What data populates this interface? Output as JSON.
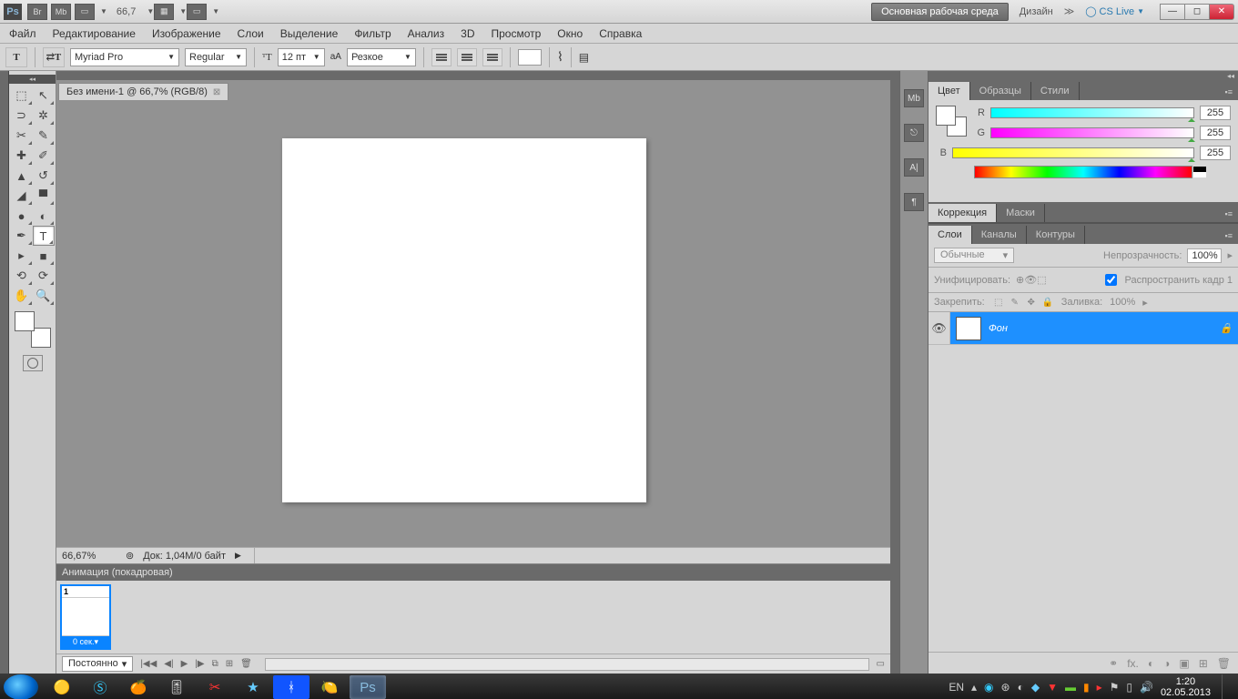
{
  "titlebar": {
    "zoom": "66,7",
    "workspace_btn": "Основная рабочая среда",
    "design_label": "Дизайн",
    "cslive": "CS Live"
  },
  "menubar": [
    "Файл",
    "Редактирование",
    "Изображение",
    "Слои",
    "Выделение",
    "Фильтр",
    "Анализ",
    "3D",
    "Просмотр",
    "Окно",
    "Справка"
  ],
  "optbar": {
    "font_family": "Myriad Pro",
    "font_style": "Regular",
    "font_size": "12 пт",
    "aa_label": "aA",
    "aa_mode": "Резкое"
  },
  "document": {
    "tab_title": "Без имени-1 @ 66,7% (RGB/8)",
    "status_zoom": "66,67%",
    "status_doc": "Док: 1,04M/0 байт"
  },
  "animation": {
    "panel_title": "Анимация (покадровая)",
    "frame_num": "1",
    "frame_time": "0 сек.",
    "loop_mode": "Постоянно"
  },
  "panels": {
    "color_tabs": [
      "Цвет",
      "Образцы",
      "Стили"
    ],
    "rgb": {
      "r_label": "R",
      "g_label": "G",
      "b_label": "B",
      "r": "255",
      "g": "255",
      "b": "255"
    },
    "adj_tabs": [
      "Коррекция",
      "Маски"
    ],
    "layer_tabs": [
      "Слои",
      "Каналы",
      "Контуры"
    ],
    "blend_mode": "Обычные",
    "opacity_label": "Непрозрачность:",
    "opacity_val": "100%",
    "unify_label": "Унифицировать:",
    "propagate_label": "Распространить кадр 1",
    "lock_label": "Закрепить:",
    "fill_label": "Заливка:",
    "fill_val": "100%",
    "layer_name": "Фон"
  },
  "taskbar": {
    "lang": "EN",
    "time": "1:20",
    "date": "02.05.2013"
  }
}
